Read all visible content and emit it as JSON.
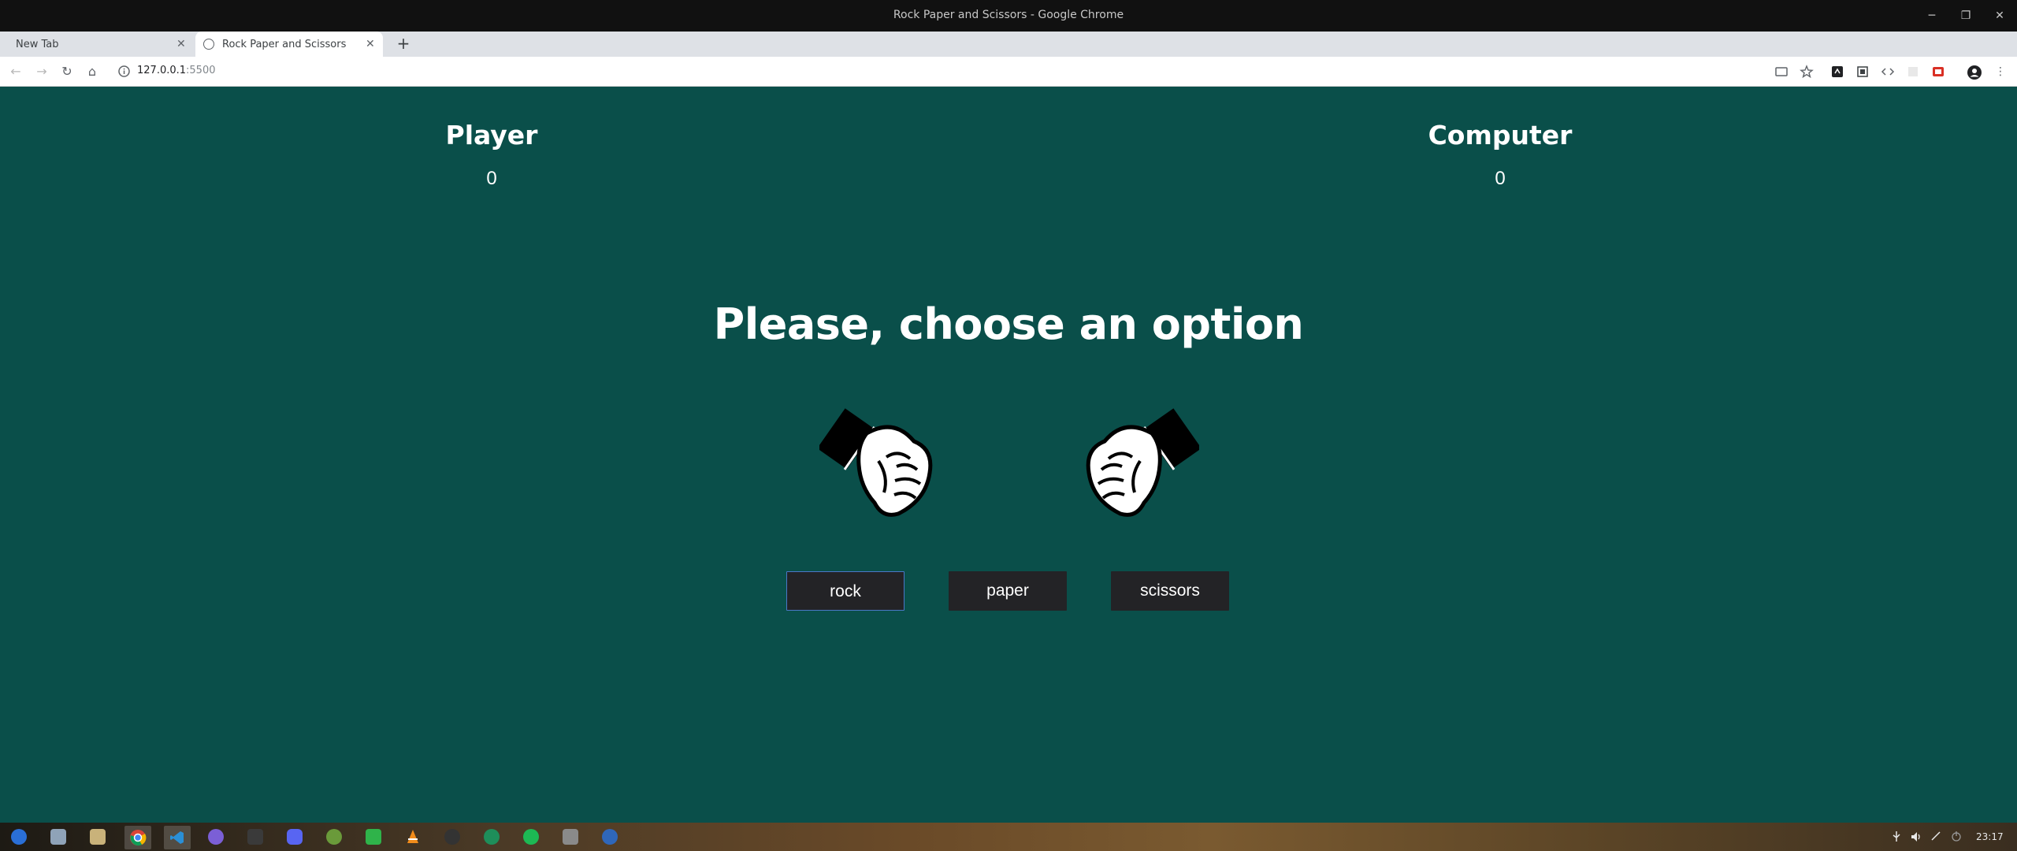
{
  "window": {
    "title": "Rock Paper and Scissors - Google Chrome",
    "minimize_glyph": "─",
    "restore_glyph": "❐",
    "close_glyph": "✕"
  },
  "tabs": [
    {
      "label": "New Tab",
      "active": false
    },
    {
      "label": "Rock Paper and Scissors",
      "active": true
    }
  ],
  "tab_close_glyph": "✕",
  "new_tab_glyph": "+",
  "toolbar": {
    "back_glyph": "←",
    "forward_glyph": "→",
    "reload_glyph": "↻",
    "home_glyph": "⌂",
    "url_host": "127.0.0.1",
    "url_port": ":5500",
    "menu_glyph": "⋮"
  },
  "game": {
    "player_label": "Player",
    "player_score": "0",
    "computer_label": "Computer",
    "computer_score": "0",
    "prompt": "Please, choose an option",
    "options": [
      "rock",
      "paper",
      "scissors"
    ],
    "focused_option": "rock"
  },
  "colors": {
    "page_background": "#0a4f4a",
    "button_background": "#232326",
    "focus_outline": "#4a78c8"
  },
  "taskbar": {
    "apps": [
      "launcher-icon",
      "file-manager-icon",
      "files-icon",
      "chrome-icon",
      "vscode-icon",
      "firefox-icon",
      "terminal-icon",
      "discord-icon",
      "android-studio-icon",
      "spreadsheet-icon",
      "vlc-icon",
      "github-icon",
      "maps-icon",
      "spotify-icon",
      "layers-icon",
      "qbittorrent-icon"
    ],
    "clock": "23:17"
  }
}
